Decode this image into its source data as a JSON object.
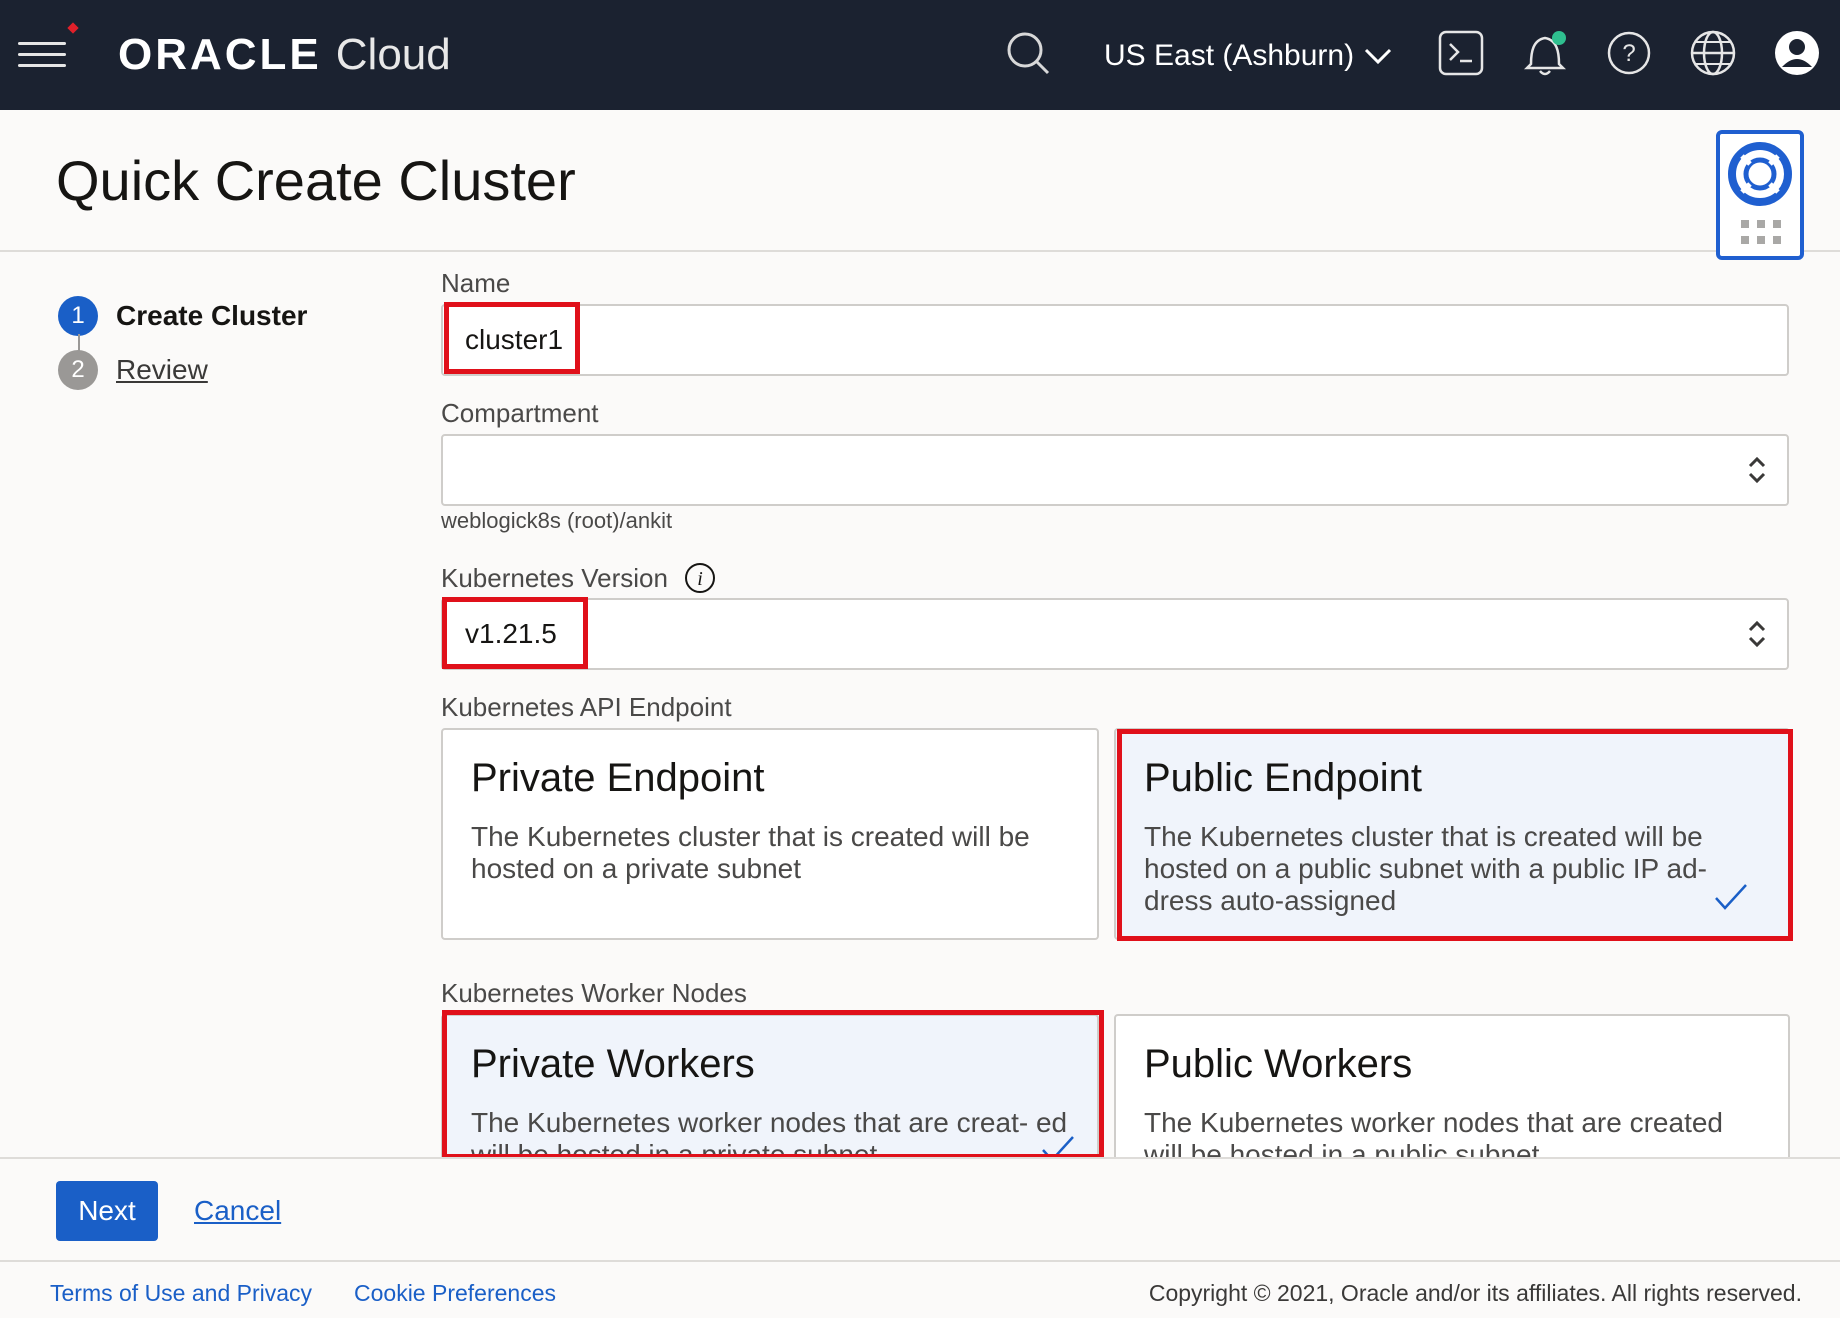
{
  "topbar": {
    "brand_oracle": "ORACLE",
    "brand_cloud": "Cloud",
    "region": "US East (Ashburn)",
    "icons": [
      "menu-icon",
      "search-icon",
      "chevron-down-icon",
      "terminal-icon",
      "bell-icon",
      "help-icon",
      "globe-icon",
      "user-icon"
    ]
  },
  "header": {
    "title": "Quick Create Cluster"
  },
  "steps": [
    {
      "num": "1",
      "label": "Create Cluster"
    },
    {
      "num": "2",
      "label": "Review"
    }
  ],
  "form": {
    "name_label": "Name",
    "name_value": "cluster1",
    "compartment_label": "Compartment",
    "compartment_value": "",
    "compartment_path": "weblogick8s (root)/ankit",
    "version_label": "Kubernetes Version",
    "version_value": "v1.21.5",
    "api_endpoint_label": "Kubernetes API Endpoint",
    "private_endpoint": {
      "title": "Private Endpoint",
      "desc": "The Kubernetes cluster that is created will be hosted on a private subnet"
    },
    "public_endpoint": {
      "title": "Public Endpoint",
      "desc": "The Kubernetes cluster that is created will be hosted on a public subnet with a public IP ad- dress auto-assigned"
    },
    "worker_nodes_label": "Kubernetes Worker Nodes",
    "private_workers": {
      "title": "Private Workers",
      "desc": "The Kubernetes worker nodes that are creat- ed will be hosted in a private subnet"
    },
    "public_workers": {
      "title": "Public Workers",
      "desc": "The Kubernetes worker nodes that are created will be hosted in a public subnet"
    }
  },
  "actions": {
    "next": "Next",
    "cancel": "Cancel"
  },
  "footer": {
    "terms": "Terms of Use and Privacy",
    "cookies": "Cookie Preferences",
    "copyright": "Copyright © 2021, Oracle and/or its affiliates. All rights reserved."
  },
  "colors": {
    "topbar_bg": "#1b2230",
    "accent_blue": "#1a5fc7",
    "highlight_red": "#e0101a",
    "selected_card_bg": "#f0f4fb",
    "notification_dot": "#2fbf8f"
  }
}
